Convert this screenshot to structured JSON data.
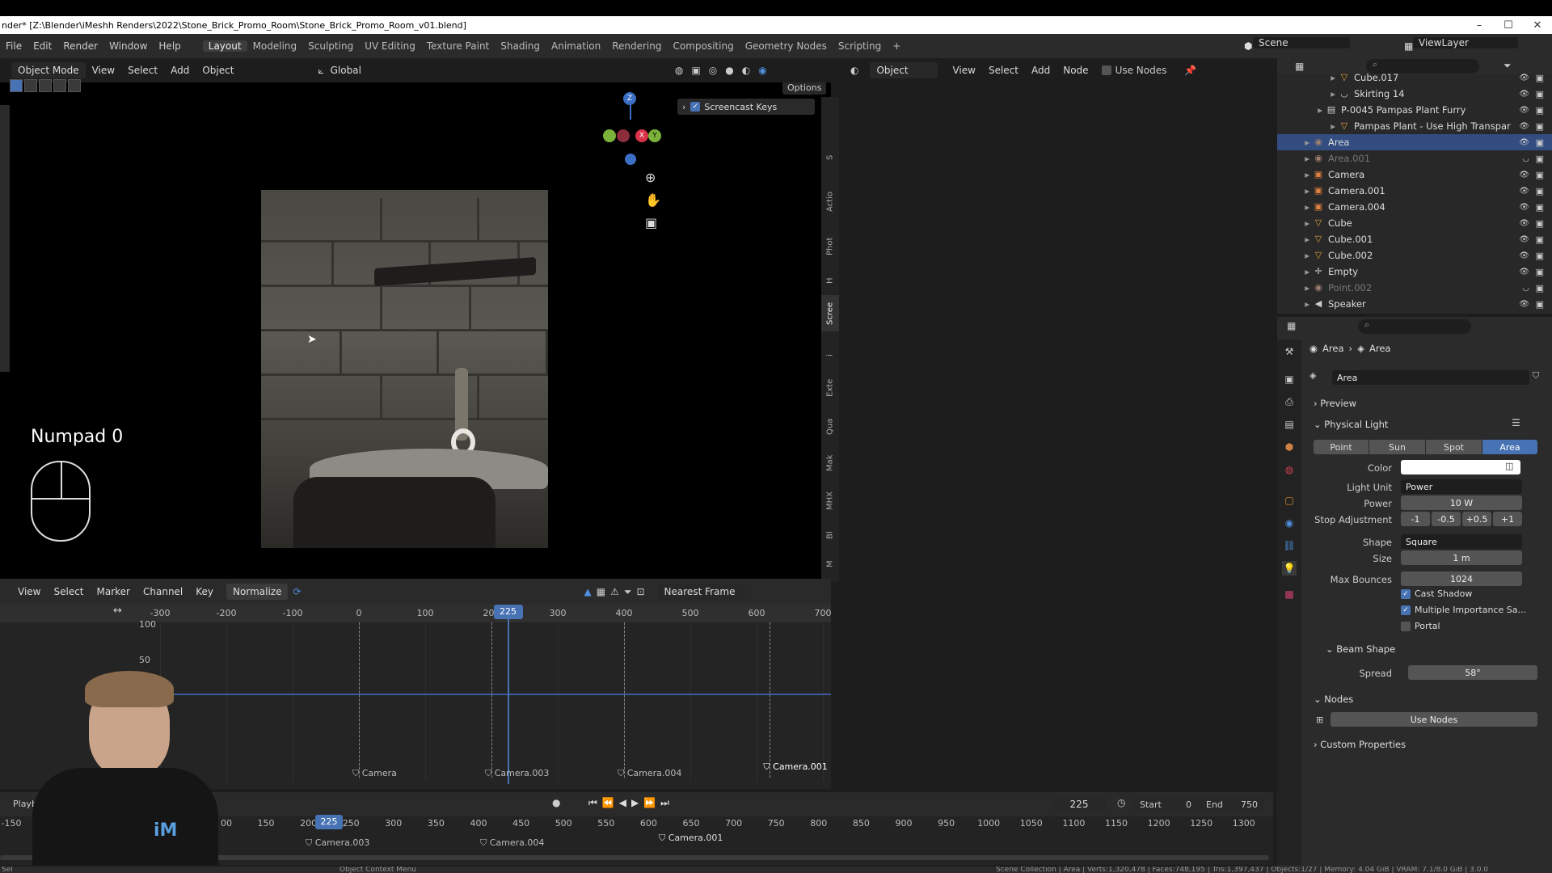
{
  "titlebar": {
    "title": "nder* [Z:\\Blender\\iMeshh Renders\\2022\\Stone_Brick_Promo_Room\\Stone_Brick_Promo_Room_v01.blend]",
    "min": "–",
    "max": "☐",
    "close": "✕"
  },
  "menu": {
    "items": [
      "File",
      "Edit",
      "Render",
      "Window",
      "Help"
    ],
    "workspaces": [
      "Layout",
      "Modeling",
      "Sculpting",
      "UV Editing",
      "Texture Paint",
      "Shading",
      "Animation",
      "Rendering",
      "Compositing",
      "Geometry Nodes",
      "Scripting"
    ],
    "add": "+",
    "scene": "Scene",
    "view_layer": "ViewLayer"
  },
  "viewport_header": {
    "mode": "Object Mode",
    "view": "View",
    "select": "Select",
    "add": "Add",
    "object": "Object",
    "orientation": "Global",
    "options": "Options"
  },
  "viewport": {
    "screencast_label": "Screencast Keys",
    "key_display": "Numpad 0",
    "gizmo_z": "Z",
    "gizmo_x": "X",
    "gizmo_y": "Y",
    "tabs": [
      "S",
      "Actio",
      "Phot",
      "H",
      "Scree",
      "i",
      "Exte",
      "Qua",
      "Mak",
      "MHX",
      "Bl",
      "M"
    ]
  },
  "graph_header": {
    "view": "View",
    "select": "Select",
    "marker": "Marker",
    "channel": "Channel",
    "key": "Key",
    "normalize": "Normalize",
    "snap": "Nearest Frame"
  },
  "graph": {
    "x_ticks": [
      "-300",
      "-200",
      "-100",
      "0",
      "100",
      "200",
      "300",
      "400",
      "500",
      "600",
      "700"
    ],
    "y_ticks": [
      "100",
      "50"
    ],
    "current_frame": "225",
    "markers": [
      "Camera",
      "Camera.003",
      "Camera.004",
      "Camera.001"
    ]
  },
  "timeline": {
    "playback": "Playbac",
    "frame": "225",
    "start_label": "Start",
    "start": "0",
    "end_label": "End",
    "end": "750",
    "ticks": [
      "-150",
      "00",
      "150",
      "200",
      "250",
      "300",
      "350",
      "400",
      "450",
      "500",
      "550",
      "600",
      "650",
      "700",
      "750",
      "800",
      "850",
      "900",
      "950",
      "1000",
      "1050",
      "1100",
      "1150",
      "1200",
      "1250",
      "1300"
    ],
    "current": "225",
    "markers": [
      "Camera.003",
      "Camera.004",
      "Camera.001"
    ]
  },
  "status": {
    "left": "Sel",
    "context": "Object Context Menu",
    "right": "Scene Collection | Area | Verts:1,320,478 | Faces:748,195 | Tris:1,397,437 | Objects:1/27 | Memory: 4.04 GiB | VRAM: 7.1/8.0 GiB | 3.0.0"
  },
  "node_header": {
    "type": "Object",
    "view": "View",
    "select": "Select",
    "add": "Add",
    "node": "Node",
    "use_nodes": "Use Nodes"
  },
  "outliner": {
    "rows": [
      {
        "name": "Cube.017",
        "indent": 3,
        "icon": "▽",
        "dim": false
      },
      {
        "name": "Skirting 14",
        "indent": 3,
        "icon": "◡",
        "dim": false
      },
      {
        "name": "P-0045 Pampas Plant Furry",
        "indent": 2,
        "icon": "▤",
        "dim": false
      },
      {
        "name": "Pampas Plant - Use High Transpar",
        "indent": 3,
        "icon": "▽",
        "dim": false
      },
      {
        "name": "Area",
        "indent": 1,
        "icon": "◉",
        "dim": false
      },
      {
        "name": "Area.001",
        "indent": 1,
        "icon": "◉",
        "dim": true
      },
      {
        "name": "Camera",
        "indent": 1,
        "icon": "▣",
        "dim": false
      },
      {
        "name": "Camera.001",
        "indent": 1,
        "icon": "▣",
        "dim": false
      },
      {
        "name": "Camera.004",
        "indent": 1,
        "icon": "▣",
        "dim": false
      },
      {
        "name": "Cube",
        "indent": 1,
        "icon": "▽",
        "dim": false
      },
      {
        "name": "Cube.001",
        "indent": 1,
        "icon": "▽",
        "dim": false
      },
      {
        "name": "Cube.002",
        "indent": 1,
        "icon": "▽",
        "dim": false
      },
      {
        "name": "Empty",
        "indent": 1,
        "icon": "✛",
        "dim": false
      },
      {
        "name": "Point.002",
        "indent": 1,
        "icon": "◉",
        "dim": true
      },
      {
        "name": "Speaker",
        "indent": 1,
        "icon": "◀",
        "dim": false
      }
    ]
  },
  "properties": {
    "breadcrumb_obj": "Area",
    "breadcrumb_data": "Area",
    "datablock": "Area",
    "preview": "Preview",
    "physical_light": "Physical Light",
    "types": [
      "Point",
      "Sun",
      "Spot",
      "Area"
    ],
    "color_label": "Color",
    "light_unit_label": "Light Unit",
    "light_unit": "Power",
    "power_label": "Power",
    "power": "10 W",
    "stop_label": "Stop Adjustment",
    "stops": [
      "-1",
      "-0.5",
      "+0.5",
      "+1"
    ],
    "shape_label": "Shape",
    "shape": "Square",
    "size_label": "Size",
    "size": "1 m",
    "bounces_label": "Max Bounces",
    "bounces": "1024",
    "cast_shadow": "Cast Shadow",
    "mis": "Multiple Importance Sa...",
    "portal": "Portal",
    "beam_shape": "Beam Shape",
    "spread_label": "Spread",
    "spread": "58°",
    "nodes": "Nodes",
    "use_nodes": "Use Nodes",
    "custom": "Custom Properties"
  },
  "colors": {
    "accent": "#4772b3",
    "selection": "#334d80",
    "light_color": "#ffffff"
  }
}
